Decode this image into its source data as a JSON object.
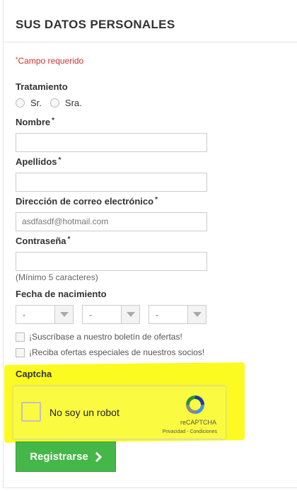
{
  "form": {
    "title": "SUS DATOS PERSONALES",
    "required_note": "Campo requerido",
    "required_mark": "*",
    "tratamiento": {
      "label": "Tratamiento",
      "options": [
        "Sr.",
        "Sra."
      ]
    },
    "nombre": {
      "label": "Nombre",
      "value": ""
    },
    "apellidos": {
      "label": "Apellidos",
      "value": ""
    },
    "email": {
      "label": "Dirección de correo electrónico",
      "value": "asdfasdf@hotmail.com"
    },
    "password": {
      "label": "Contraseña",
      "value": "",
      "hint": "(Mínimo 5 caracteres)"
    },
    "birthdate": {
      "label": "Fecha de nacimiento",
      "day": "-",
      "month": "-",
      "year": "-"
    },
    "newsletter_label": "¡Suscríbase a nuestro boletín de ofertas!",
    "partners_label": "¡Reciba ofertas especiales de nuestros socios!",
    "captcha": {
      "label": "Captcha",
      "checkbox_text": "No soy un robot",
      "brand": "reCAPTCHA",
      "links": "Privacidad - Condiciones"
    },
    "submit_label": "Registrarse"
  },
  "colors": {
    "required": "#d0322e",
    "submit": "#44b748",
    "highlight": "#fbfb22"
  }
}
